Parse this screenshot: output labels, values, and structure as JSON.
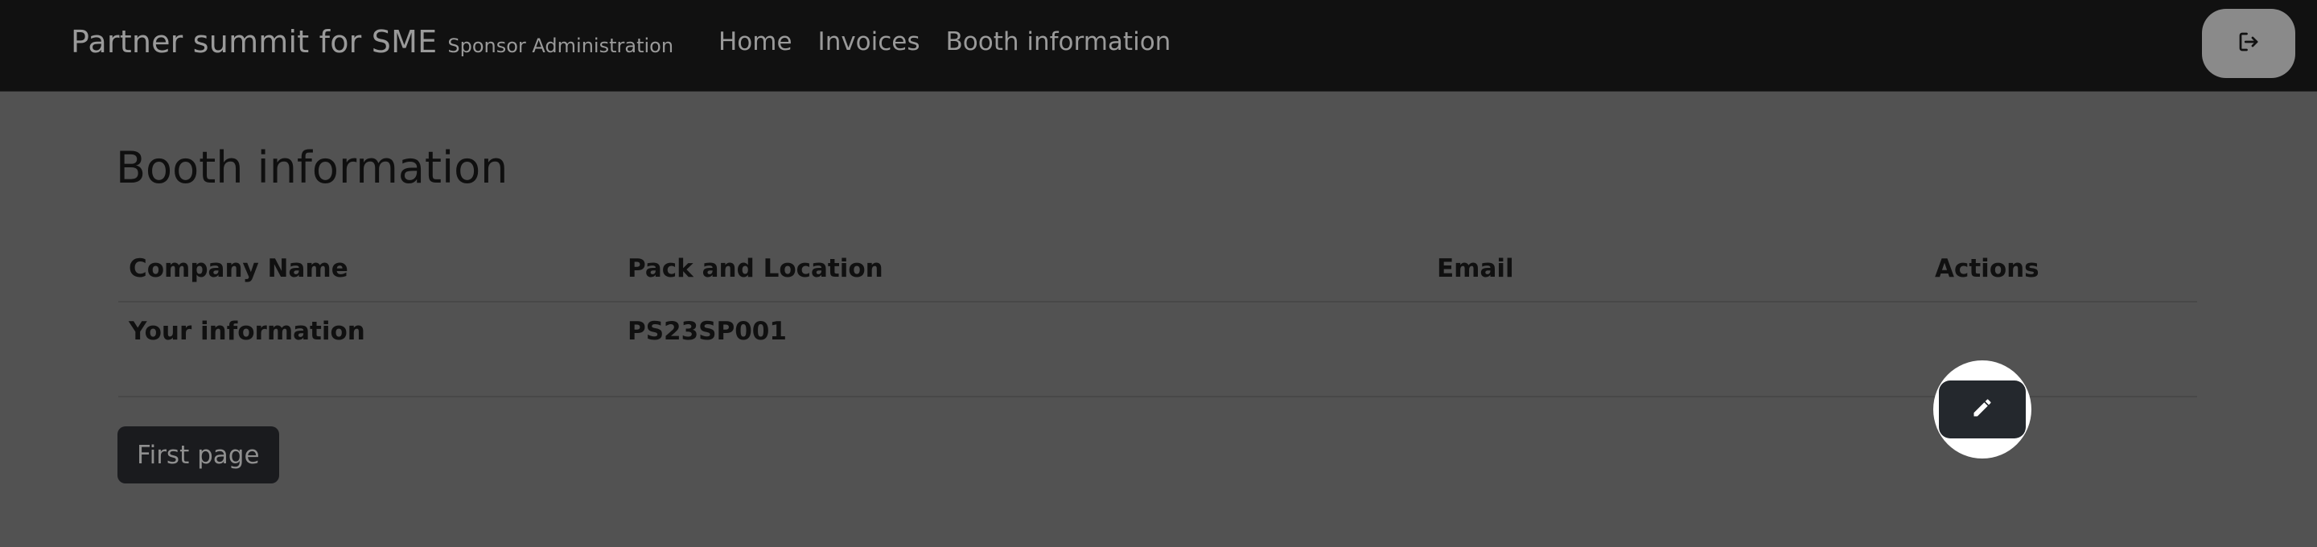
{
  "navbar": {
    "brand_title": "Partner summit for SME",
    "brand_subtitle": "Sponsor Administration",
    "links": [
      "Home",
      "Invoices",
      "Booth information"
    ],
    "logout_icon": "logout-icon"
  },
  "page": {
    "title": "Booth information"
  },
  "table": {
    "headers": [
      "Company Name",
      "Pack and Location",
      "Email",
      "Actions"
    ],
    "rows": [
      {
        "company_name": "Your information",
        "pack_and_location": "PS23SP001",
        "email": "",
        "action_icon": "pencil-icon"
      }
    ]
  },
  "pagination": {
    "first_page_label": "First page"
  },
  "colors": {
    "navbar_bg": "#111111",
    "page_bg": "#525252",
    "button_dark": "#24282d",
    "spotlight": "#ffffff"
  }
}
